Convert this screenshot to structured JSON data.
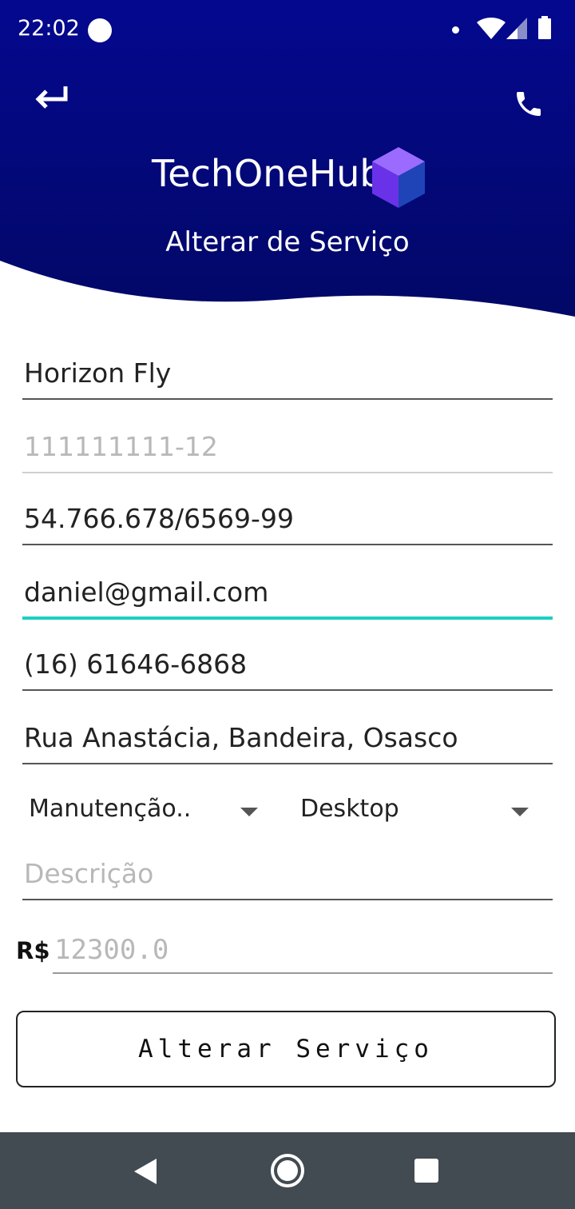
{
  "status_bar": {
    "time": "22:02"
  },
  "header": {
    "app_name": "TechOneHub",
    "subtitle": "Alterar de Serviço",
    "colors": {
      "gradient_top": "#04088f",
      "gradient_bottom": "#020866"
    },
    "icons": {
      "back": "return-arrow-icon",
      "call": "phone-icon",
      "logo": "cube-logo-icon"
    }
  },
  "form": {
    "name": {
      "value": "Horizon Fly",
      "is_placeholder": false
    },
    "code": {
      "value": "111111111-12",
      "is_placeholder": true
    },
    "cnpj": {
      "value": "54.766.678/6569-99",
      "is_placeholder": false
    },
    "email": {
      "value": "daniel@gmail.com",
      "is_placeholder": false,
      "focused": true
    },
    "phone": {
      "value": "(16) 61646-6868",
      "is_placeholder": false
    },
    "address": {
      "value": "Rua Anastácia, Bandeira, Osasco",
      "is_placeholder": false
    },
    "service_type": {
      "selected": "Manutenção.."
    },
    "device_type": {
      "selected": "Desktop"
    },
    "description": {
      "placeholder": "Descrição"
    },
    "price": {
      "currency": "R$",
      "placeholder": "12300.0"
    },
    "submit_label": "Alterar Serviço",
    "accent_color": "#1ccfc3"
  },
  "nav_bar": {
    "icons": [
      "back-triangle-icon",
      "home-circle-icon",
      "recents-square-icon"
    ]
  }
}
